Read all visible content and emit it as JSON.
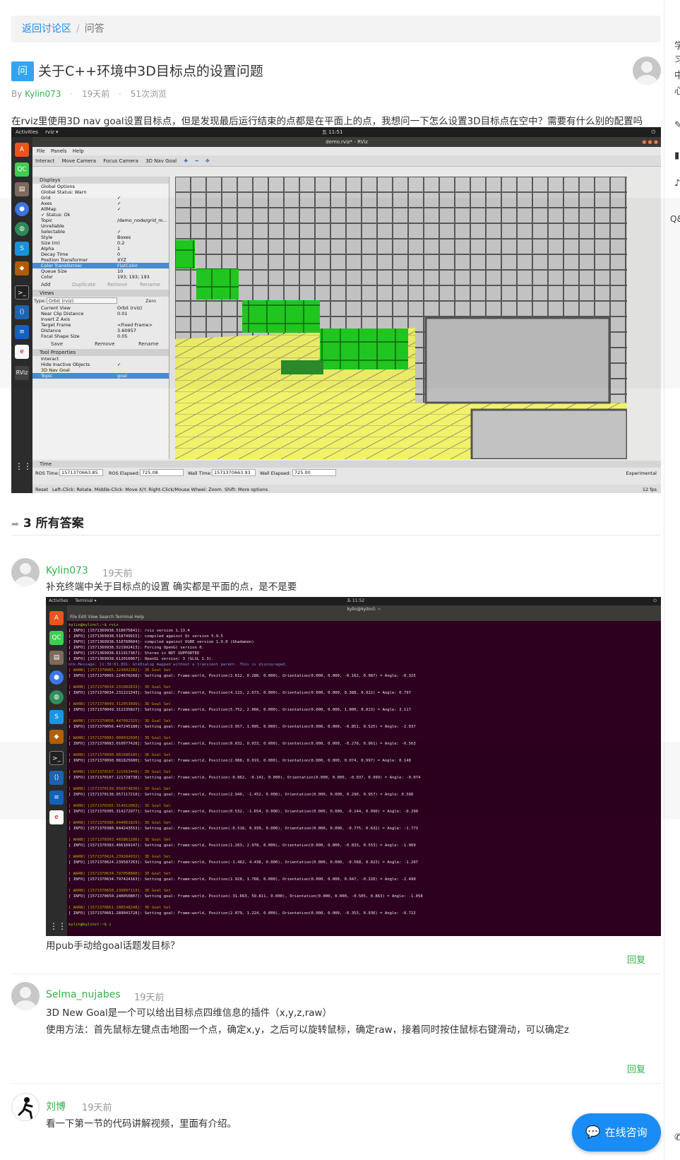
{
  "breadcrumb": {
    "back": "返回讨论区",
    "separator": "/",
    "current": "问答"
  },
  "question": {
    "badge": "问",
    "title": "关于C++环境中3D目标点的设置问题",
    "by": "By",
    "author": "Kylin073",
    "time": "19天前",
    "views": "51次浏览",
    "body": "在rviz里使用3D nav goal设置目标点，但是发现最后运行结束的点都是在平面上的点，我想问一下怎么设置3D目标点在空中？需要有什么别的配置吗"
  },
  "rviz": {
    "activities": "Activities",
    "app": "rviz ▾",
    "clock": "五 11:51",
    "win_title": "demo.rviz* - RViz",
    "menu": [
      "File",
      "Panels",
      "Help"
    ],
    "tools": [
      "Interact",
      "Move Camera",
      "Focus Camera",
      "3D Nav Goal"
    ],
    "displays_header": "Displays",
    "displays": [
      {
        "k": "Global Options",
        "v": ""
      },
      {
        "k": "Global Status: Warn",
        "v": ""
      },
      {
        "k": "Grid",
        "v": "✓"
      },
      {
        "k": "Axes",
        "v": "✓"
      },
      {
        "k": "AllMap",
        "v": "✓"
      },
      {
        "k": "✓ Status: Ok",
        "v": ""
      },
      {
        "k": "Topic",
        "v": "/demo_node/grid_m..."
      },
      {
        "k": "Unreliable",
        "v": ""
      },
      {
        "k": "Selectable",
        "v": "✓"
      },
      {
        "k": "Style",
        "v": "Boxes"
      },
      {
        "k": "Size (m)",
        "v": "0.2"
      },
      {
        "k": "Alpha",
        "v": "1"
      },
      {
        "k": "Decay Time",
        "v": "0"
      },
      {
        "k": "Position Transformer",
        "v": "XYZ"
      },
      {
        "k": "Color Transformer",
        "v": "FlatColor"
      },
      {
        "k": "Queue Size",
        "v": "10"
      },
      {
        "k": "Color",
        "v": "193; 193; 193"
      }
    ],
    "display_buttons": [
      "Add",
      "Duplicate",
      "Remove",
      "Rename"
    ],
    "views_header": "Views",
    "views_type_label": "Type:",
    "views_type": "Orbit (rviz)",
    "views_zero": "Zero",
    "views": [
      {
        "k": "Current View",
        "v": "Orbit (rviz)"
      },
      {
        "k": "Near Clip Distance",
        "v": "0.01"
      },
      {
        "k": "Invert Z Axis",
        "v": ""
      },
      {
        "k": "Target Frame",
        "v": "<Fixed Frame>"
      },
      {
        "k": "Distance",
        "v": "3.60957"
      },
      {
        "k": "Focal Shape Size",
        "v": "0.05"
      }
    ],
    "view_buttons": [
      "Save",
      "Remove",
      "Rename"
    ],
    "tool_header": "Tool Properties",
    "tools_props": [
      {
        "k": "Interact",
        "v": ""
      },
      {
        "k": "Hide Inactive Objects",
        "v": "✓"
      },
      {
        "k": "3D Nav Goal",
        "v": ""
      },
      {
        "k": "Topic",
        "v": "goal"
      }
    ],
    "time_header": "Time",
    "ros_time_label": "ROS Time:",
    "ros_time": "1571370663.85",
    "ros_elapsed_label": "ROS Elapsed:",
    "ros_elapsed": "725.08",
    "wall_time_label": "Wall Time:",
    "wall_time": "1571370663.93",
    "wall_elapsed_label": "Wall Elapsed:",
    "wall_elapsed": "725.00",
    "experimental": "Experimental",
    "reset": "Reset",
    "hint": "Left-Click: Rotate. Middle-Click: Move X/Y. Right-Click/Mouse Wheel: Zoom. Shift: More options.",
    "fps": "12 fps"
  },
  "answers_header": "3 所有答案",
  "answers": [
    {
      "author": "Kylin073",
      "time": "19天前",
      "text1": "补充终端中关于目标点的设置 确实都是平面的点，是不是要",
      "text2": "用pub手动给goal话题发目标？",
      "reply": "回复"
    },
    {
      "author": "Selma_nujabes",
      "time": "19天前",
      "text1": "3D New Goal是一个可以给出目标点四维信息的插件（x,y,z,raw）",
      "text2": "使用方法：首先鼠标左键点击地图一个点，确定x,y，之后可以旋转鼠标，确定raw，接着同时按住鼠标右键滑动，可以确定z",
      "reply": "回复"
    },
    {
      "author": "刘博",
      "time": "19天前",
      "text1": "看一下第一节的代码讲解视频，里面有介绍。"
    }
  ],
  "terminal": {
    "activities": "Activities",
    "app": "Terminal ▾",
    "clock": "五 11:52",
    "title": "kylin@kylincl: ~",
    "menu": "File  Edit  View  Search  Terminal  Help",
    "lines": [
      {
        "c": "g",
        "t": "kylin@kylincl:~$ rviz"
      },
      {
        "c": "",
        "t": "[ INFO] [1571369938.518675841]: rviz version 1.13.4"
      },
      {
        "c": "",
        "t": "[ INFO] [1571369938.518749915]: compiled against Qt version 5.9.5"
      },
      {
        "c": "",
        "t": "[ INFO] [1571369938.518760604]: compiled against OGRE version 1.9.0 (Ghadamon)"
      },
      {
        "c": "",
        "t": "[ INFO] [1571369938.521992413]: Forcing OpenGl version 0."
      },
      {
        "c": "",
        "t": "[ INFO] [1571369938.611917367]: Stereo is NOT SUPPORTED"
      },
      {
        "c": "",
        "t": "[ INFO] [1571369938.612016067]: OpenGL version: 3 (GLSL 1.3)."
      },
      {
        "c": "b",
        "t": "Gtk-Message: 11:39:01.891: GtkDialog mapped without a transient parent. This is discouraged."
      },
      {
        "c": "w",
        "t": "[ WARN] [1571370065.223602282]: 3D Goal Set"
      },
      {
        "c": "",
        "t": "[ INFO] [1571370065.224670268]: Setting goal: Frame:world, Position(2.612, 0.280, 0.000), Orientation(0.000, 0.000, -0.162, 0.987) = Angle: -0.325"
      },
      {
        "c": "",
        "t": ""
      },
      {
        "c": "w",
        "t": "[ WARN] [1571370034.231082633]: 3D Goal Set"
      },
      {
        "c": "",
        "t": "[ INFO] [1571370034.231221343]: Setting goal: Frame:world, Position(4.123, 2.673, 0.000), Orientation(0.000, 0.000, 0.388, 0.922) = Angle: 0.797"
      },
      {
        "c": "",
        "t": ""
      },
      {
        "c": "w",
        "t": "[ WARN] [1571370049.312053899]: 3D Goal Set"
      },
      {
        "c": "",
        "t": "[ INFO] [1571370049.312235827]: Setting goal: Frame:world, Position(5.752, 2.066, 0.000), Orientation(0.000, 0.000, 1.000, 0.013) = Angle: 3.117"
      },
      {
        "c": "",
        "t": ""
      },
      {
        "c": "w",
        "t": "[ WARN] [1571370056.447092325]: 3D Goal Set"
      },
      {
        "c": "",
        "t": "[ INFO] [1571370056.447245188]: Setting goal: Frame:world, Position(3.957, 1.095, 0.000), Orientation(0.000, 0.000, -0.851, 0.525) = Angle: -2.037"
      },
      {
        "c": "",
        "t": ""
      },
      {
        "c": "w",
        "t": "[ WARN] [1571370083.009932690]: 3D Goal Set"
      },
      {
        "c": "",
        "t": "[ INFO] [1571370083.010077428]: Setting goal: Frame:world, Position(0.032, 0.033, 0.000), Orientation(0.000, 0.000, -0.278, 0.961) = Angle: -0.563"
      },
      {
        "c": "",
        "t": ""
      },
      {
        "c": "w",
        "t": "[ WARN] [1571370090.081680185]: 3D Goal Set"
      },
      {
        "c": "",
        "t": "[ INFO] [1571370090.081825680]: Setting goal: Frame:world, Position(2.088, 0.019, 0.000), Orientation(0.000, 0.000, 0.074, 0.997) = Angle: 0.148"
      },
      {
        "c": "",
        "t": ""
      },
      {
        "c": "w",
        "t": "[ WARN] [1571370107.121563448]: 3D Goal Set"
      },
      {
        "c": "",
        "t": "[ INFO] [1571370107.121728738]: Setting goal: Frame:world, Position(-0.862, -0.141, 0.000), Orientation(0.000, 0.000, -0.037, 0.999) = Angle: -0.074"
      },
      {
        "c": "",
        "t": ""
      },
      {
        "c": "w",
        "t": "[ WARN] [1571370138.956874830]: 3D Goal Set"
      },
      {
        "c": "",
        "t": "[ INFO] [1571370138.957117210]: Setting goal: Frame:world, Position(2.940, -1.452, 0.000), Orientation(0.000, 0.000, 0.290, 0.957) = Angle: 0.588"
      },
      {
        "c": "",
        "t": ""
      },
      {
        "c": "w",
        "t": "[ WARN] [1571370305.314012083]: 3D Goal Set"
      },
      {
        "c": "",
        "t": "[ INFO] [1571370305.314272977]: Setting goal: Frame:world, Position(0.532, -1.654, 0.000), Orientation(0.000, 0.000, -0.144, 0.990) = Angle: -0.290"
      },
      {
        "c": "",
        "t": ""
      },
      {
        "c": "w",
        "t": "[ WARN] [1571370380.644061829]: 3D Goal Set"
      },
      {
        "c": "",
        "t": "[ INFO] [1571370380.644243553]: Setting goal: Frame:world, Position(-0.518, 0.939, 0.000), Orientation(0.000, 0.000, -0.775, 0.632) = Angle: -1.773"
      },
      {
        "c": "",
        "t": ""
      },
      {
        "c": "w",
        "t": "[ WARN] [1571370393.465861286]: 3D Goal Set"
      },
      {
        "c": "",
        "t": "[ INFO] [1571370393.466169147]: Setting goal: Frame:world, Position(1.263, 2.978, 0.000), Orientation(0.000, 0.000, -0.833, 0.553) = Angle: -1.969"
      },
      {
        "c": "",
        "t": ""
      },
      {
        "c": "w",
        "t": "[ WARN] [1571370624.239284932]: 3D Goal Set"
      },
      {
        "c": "",
        "t": "[ INFO] [1571370624.239587263]: Setting goal: Frame:world, Position(-1.462, 4.438, 0.000), Orientation(0.000, 0.000, -0.568, 0.823) = Angle: -1.207"
      },
      {
        "c": "",
        "t": ""
      },
      {
        "c": "w",
        "t": "[ WARN] [1571370634.797058800]: 3D Goal Set"
      },
      {
        "c": "",
        "t": "[ INFO] [1571370634.797424163]: Setting goal: Frame:world, Position(1.928, 1.768, 0.000), Orientation(0.000, 0.000, 0.947, -0.320) = Angle: -2.490"
      },
      {
        "c": "",
        "t": ""
      },
      {
        "c": "w",
        "t": "[ WARN] [1571370650.239897119]: 3D Goal Set"
      },
      {
        "c": "",
        "t": "[ INFO] [1571370650.240050807]: Setting goal: Frame:world, Position(-31.663, 59.811, 0.000), Orientation(0.000, 0.000, -0.505, 0.863) = Angle: -1.058"
      },
      {
        "c": "",
        "t": ""
      },
      {
        "c": "w",
        "t": "[ WARN] [1571370661.288548248]: 3D Goal Set"
      },
      {
        "c": "",
        "t": "[ INFO] [1571370661.289041728]: Setting goal: Frame:world, Position(2.079, 1.224, 0.000), Orientation(0.000, 0.000, -0.353, 0.936) = Angle: -0.722"
      },
      {
        "c": "",
        "t": ""
      },
      {
        "c": "g",
        "t": "kylin@kylincl:~$ ▯"
      }
    ]
  },
  "chat": {
    "icon": "chat-bubble-icon",
    "label": "在线咨询"
  },
  "right_bar": {
    "chars": [
      "学",
      "习",
      "中",
      "心"
    ],
    "qa": "Q&"
  },
  "colors": {
    "accent": "#1a8cf6",
    "author_green": "#34b34a",
    "badge_blue": "#35a4f0",
    "link_blue": "#1e88e5"
  }
}
